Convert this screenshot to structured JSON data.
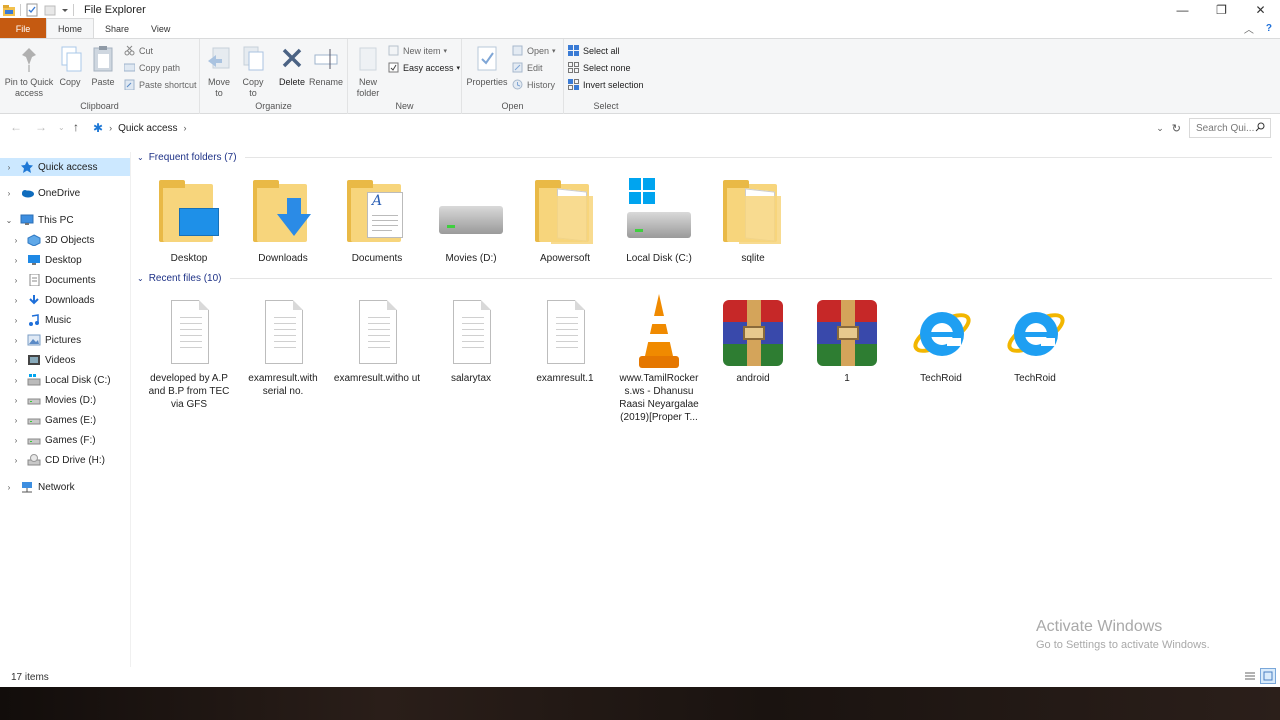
{
  "window": {
    "title": "File Explorer",
    "controls": {
      "minimize": "—",
      "maximize": "❐",
      "close": "✕"
    }
  },
  "tabs": {
    "file": "File",
    "home": "Home",
    "share": "Share",
    "view": "View"
  },
  "ribbon": {
    "clipboard": {
      "label": "Clipboard",
      "pin": "Pin to Quick access",
      "copy": "Copy",
      "paste": "Paste",
      "cut": "Cut",
      "copy_path": "Copy path",
      "paste_shortcut": "Paste shortcut"
    },
    "organize": {
      "label": "Organize",
      "move_to": "Move to",
      "copy_to": "Copy to",
      "delete": "Delete",
      "rename": "Rename"
    },
    "new": {
      "label": "New",
      "new_folder": "New folder",
      "new_item": "New item",
      "easy_access": "Easy access"
    },
    "open": {
      "label": "Open",
      "properties": "Properties",
      "open": "Open",
      "edit": "Edit",
      "history": "History"
    },
    "select": {
      "label": "Select",
      "select_all": "Select all",
      "select_none": "Select none",
      "invert_selection": "Invert selection"
    }
  },
  "address": {
    "path": "Quick access",
    "search_placeholder": "Search Qui..."
  },
  "nav": {
    "quick_access": "Quick access",
    "onedrive": "OneDrive",
    "this_pc": "This PC",
    "items": [
      {
        "label": "3D Objects",
        "icon": "3d-objects-icon"
      },
      {
        "label": "Desktop",
        "icon": "desktop-icon"
      },
      {
        "label": "Documents",
        "icon": "documents-icon"
      },
      {
        "label": "Downloads",
        "icon": "downloads-icon"
      },
      {
        "label": "Music",
        "icon": "music-icon"
      },
      {
        "label": "Pictures",
        "icon": "pictures-icon"
      },
      {
        "label": "Videos",
        "icon": "videos-icon"
      },
      {
        "label": "Local Disk (C:)",
        "icon": "local-disk-icon"
      },
      {
        "label": "Movies (D:)",
        "icon": "drive-icon"
      },
      {
        "label": "Games (E:)",
        "icon": "drive-icon"
      },
      {
        "label": "Games (F:)",
        "icon": "drive-icon"
      },
      {
        "label": "CD Drive (H:)",
        "icon": "cd-drive-icon"
      }
    ],
    "network": "Network"
  },
  "content": {
    "frequent_header": "Frequent folders (7)",
    "frequent": [
      {
        "label": "Desktop",
        "icon": "desktop-folder"
      },
      {
        "label": "Downloads",
        "icon": "downloads-folder"
      },
      {
        "label": "Documents",
        "icon": "documents-folder"
      },
      {
        "label": "Movies (D:)",
        "icon": "drive"
      },
      {
        "label": "Apowersoft",
        "icon": "folder"
      },
      {
        "label": "Local Disk (C:)",
        "icon": "windows-drive"
      },
      {
        "label": "sqlite",
        "icon": "folder"
      }
    ],
    "recent_header": "Recent files (10)",
    "recent": [
      {
        "label": "developed by A.P and B.P from TEC via GFS",
        "icon": "text-file"
      },
      {
        "label": "examresult.with serial no.",
        "icon": "text-file"
      },
      {
        "label": "examresult.witho ut",
        "icon": "text-file"
      },
      {
        "label": "salarytax",
        "icon": "text-file"
      },
      {
        "label": "examresult.1",
        "icon": "text-file"
      },
      {
        "label": "www.TamilRocker s.ws - Dhanusu Raasi Neyargalae (2019)[Proper T...",
        "icon": "vlc"
      },
      {
        "label": "android",
        "icon": "winrar"
      },
      {
        "label": "1",
        "icon": "winrar"
      },
      {
        "label": "TechRoid",
        "icon": "internet-explorer"
      },
      {
        "label": "TechRoid",
        "icon": "internet-explorer"
      }
    ]
  },
  "status": {
    "count": "17 items"
  },
  "watermark": {
    "line1": "Activate Windows",
    "line2": "Go to Settings to activate Windows."
  }
}
